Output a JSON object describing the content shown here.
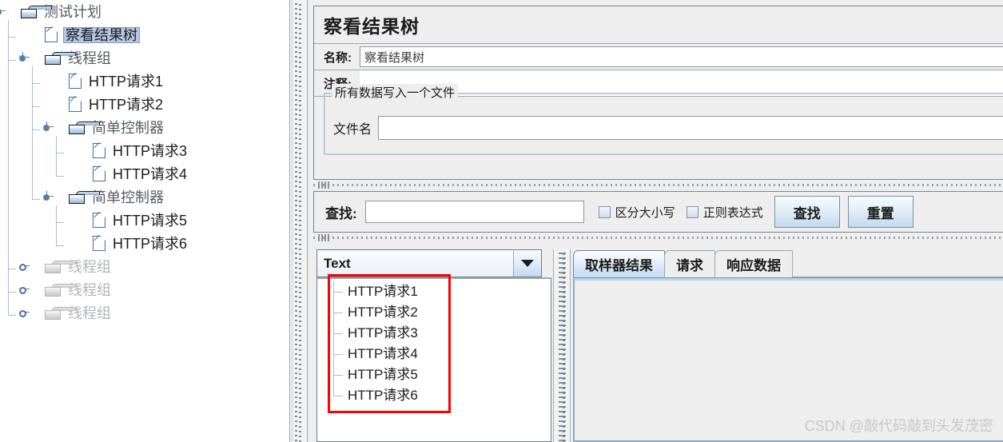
{
  "tree": {
    "nodes": [
      {
        "label": "测试计划",
        "icon": "folder-icon",
        "depth": 0,
        "knob": "expanded",
        "state": "normal"
      },
      {
        "label": "察看结果树",
        "icon": "document-icon",
        "depth": 1,
        "knob": "none",
        "state": "selected"
      },
      {
        "label": "线程组",
        "icon": "folder-icon",
        "depth": 1,
        "knob": "expanded",
        "state": "normal"
      },
      {
        "label": "HTTP请求1",
        "icon": "document-icon",
        "depth": 2,
        "knob": "none",
        "state": "normal"
      },
      {
        "label": "HTTP请求2",
        "icon": "document-icon",
        "depth": 2,
        "knob": "none",
        "state": "normal"
      },
      {
        "label": "简单控制器",
        "icon": "folder-icon",
        "depth": 2,
        "knob": "expanded",
        "state": "normal"
      },
      {
        "label": "HTTP请求3",
        "icon": "document-icon",
        "depth": 3,
        "knob": "none",
        "state": "normal"
      },
      {
        "label": "HTTP请求4",
        "icon": "document-icon",
        "depth": 3,
        "knob": "none",
        "state": "normal"
      },
      {
        "label": "简单控制器",
        "icon": "folder-icon",
        "depth": 2,
        "knob": "expanded",
        "state": "normal"
      },
      {
        "label": "HTTP请求5",
        "icon": "document-icon",
        "depth": 3,
        "knob": "none",
        "state": "normal"
      },
      {
        "label": "HTTP请求6",
        "icon": "document-icon",
        "depth": 3,
        "knob": "none",
        "state": "normal"
      },
      {
        "label": "线程组",
        "icon": "folder-icon",
        "depth": 1,
        "knob": "collapsed",
        "state": "disabled"
      },
      {
        "label": "线程组",
        "icon": "folder-icon",
        "depth": 1,
        "knob": "collapsed",
        "state": "disabled"
      },
      {
        "label": "线程组",
        "icon": "folder-icon",
        "depth": 1,
        "knob": "collapsed",
        "state": "disabled"
      }
    ]
  },
  "panel": {
    "title": "察看结果树",
    "name_label": "名称:",
    "name_value": "察看结果树",
    "comment_label": "注释:",
    "comment_value": "",
    "file_group": {
      "legend": "所有数据写入一个文件",
      "filename_label": "文件名",
      "filename_value": ""
    }
  },
  "search": {
    "label": "查找:",
    "value": "",
    "case_sensitive_label": "区分大小写",
    "case_sensitive_checked": false,
    "regex_label": "正则表达式",
    "regex_checked": false,
    "find_button": "查找",
    "reset_button": "重置"
  },
  "results": {
    "renderer_selected": "Text",
    "renderer_options": [
      "Text"
    ],
    "items": [
      "HTTP请求1",
      "HTTP请求2",
      "HTTP请求3",
      "HTTP请求4",
      "HTTP请求5",
      "HTTP请求6"
    ]
  },
  "tabs": {
    "items": [
      "取样器结果",
      "请求",
      "响应数据"
    ],
    "active_index": 0
  },
  "watermark": "CSDN @敲代码敲到头发茂密",
  "colors": {
    "highlight_box": "#fe0000",
    "selection": "#b6c7e3",
    "panel_bg": "#eeeeee",
    "accent": "#5d86b8"
  }
}
